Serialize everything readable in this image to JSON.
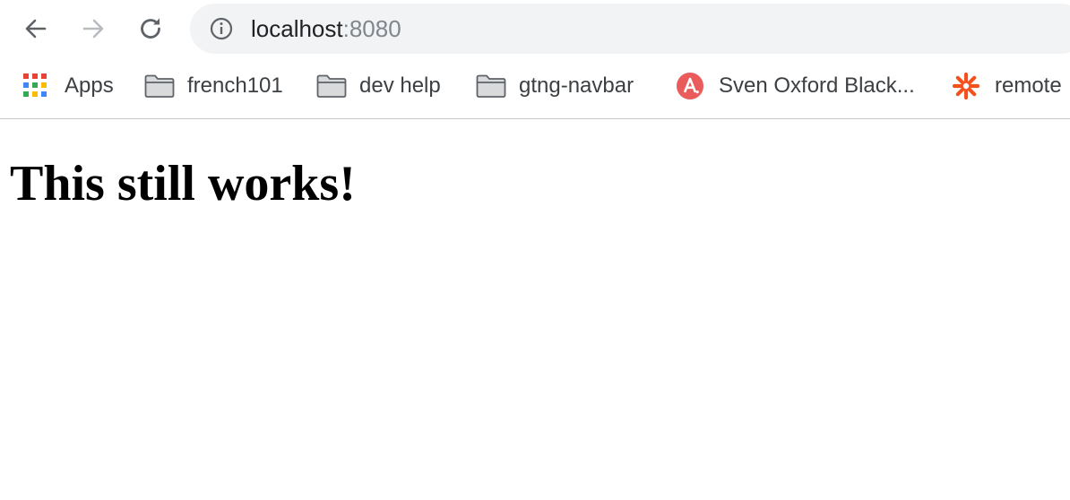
{
  "toolbar": {
    "back_icon": "back-arrow-icon",
    "forward_icon": "forward-arrow-icon",
    "reload_icon": "reload-icon",
    "address": {
      "info_icon": "info-icon",
      "host": "localhost",
      "port": ":8080"
    }
  },
  "bookmarks": {
    "items": [
      {
        "label": "Apps",
        "icon": "apps-grid-icon"
      },
      {
        "label": "french101",
        "icon": "folder-icon"
      },
      {
        "label": "dev help",
        "icon": "folder-icon"
      },
      {
        "label": "gtng-navbar",
        "icon": "folder-icon"
      },
      {
        "label": "Sven Oxford Black...",
        "icon": "red-circle-a-icon"
      },
      {
        "label": "remote",
        "icon": "orange-asterisk-icon"
      }
    ]
  },
  "page": {
    "heading": "This still works!"
  },
  "colors": {
    "omnibox_bg": "#f1f3f4",
    "text": "#202124",
    "port_text": "#80868b",
    "red_badge": "#ea5b5b",
    "orange_icon": "#f4511e"
  }
}
